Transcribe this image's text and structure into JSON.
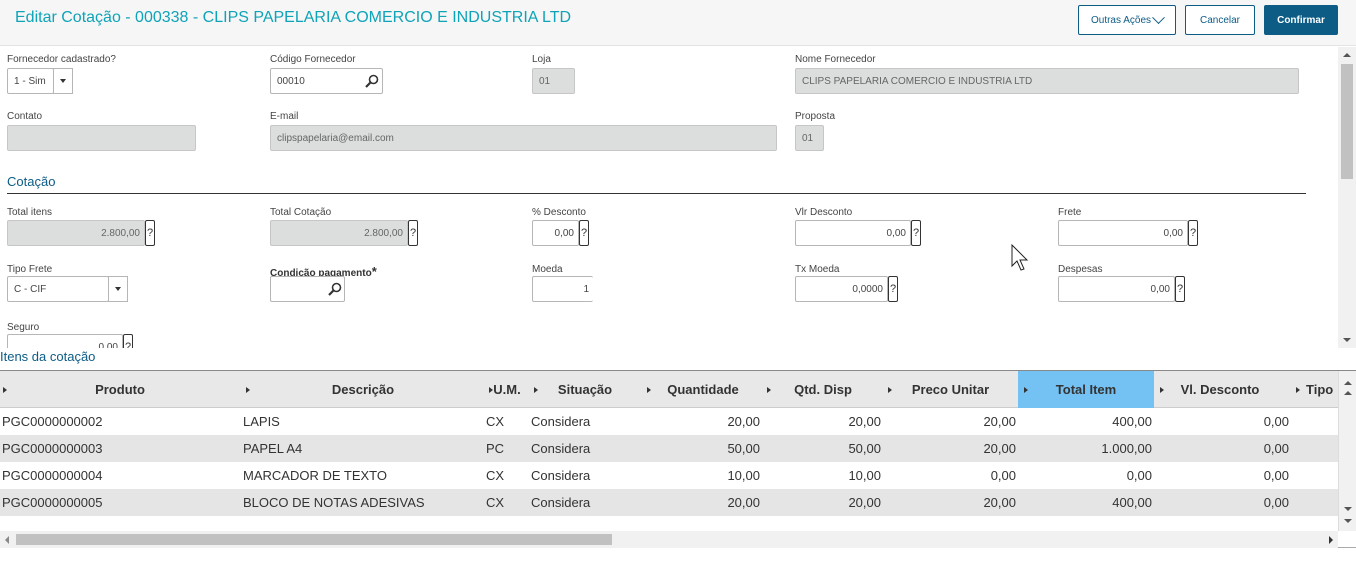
{
  "header": {
    "title": "Editar Cotação -  000338 - CLIPS PAPELARIA COMERCIO E INDUSTRIA LTD",
    "actions_label": "Outras Ações",
    "cancel_label": "Cancelar",
    "confirm_label": "Confirmar"
  },
  "form": {
    "fornecedor_cadastrado": {
      "label": "Fornecedor cadastrado?",
      "value": "1 - Sim"
    },
    "codigo_fornecedor": {
      "label": "Código Fornecedor",
      "value": "00010"
    },
    "loja": {
      "label": "Loja",
      "value": "01"
    },
    "nome_fornecedor": {
      "label": "Nome Fornecedor",
      "value": "CLIPS PAPELARIA COMERCIO E INDUSTRIA LTD"
    },
    "contato": {
      "label": "Contato",
      "value": ""
    },
    "email": {
      "label": "E-mail",
      "value": "clipspapelaria@email.com"
    },
    "proposta": {
      "label": "Proposta",
      "value": "01"
    }
  },
  "cotacao": {
    "section_title": "Cotação",
    "total_itens": {
      "label": "Total itens",
      "value": "2.800,00"
    },
    "total_cotacao": {
      "label": "Total Cotação",
      "value": "2.800,00"
    },
    "desconto_pct": {
      "label": "% Desconto",
      "value": "0,00"
    },
    "vlr_desconto": {
      "label": "Vlr Desconto",
      "value": "0,00"
    },
    "frete": {
      "label": "Frete",
      "value": "0,00"
    },
    "tipo_frete": {
      "label": "Tipo Frete",
      "value": "C - CIF"
    },
    "condicao_pagamento": {
      "label": "Condição pagamento",
      "required_mark": "*",
      "value": ""
    },
    "moeda": {
      "label": "Moeda",
      "value": "1"
    },
    "tx_moeda": {
      "label": "Tx Moeda",
      "value": "0,0000"
    },
    "despesas": {
      "label": "Despesas",
      "value": "0,00"
    },
    "seguro": {
      "label": "Seguro",
      "value": "0,00"
    },
    "help_glyph": "?"
  },
  "items": {
    "title": "Itens da cotação",
    "columns": [
      "Produto",
      "Descrição",
      "U.M.",
      "Situação",
      "Quantidade",
      "Qtd. Disp",
      "Preco Unitar",
      "Total Item",
      "Vl. Desconto",
      "Tipo"
    ],
    "rows": [
      [
        "PGC0000000002",
        "LAPIS",
        "CX",
        "Considera",
        "20,00",
        "20,00",
        "20,00",
        "400,00",
        "0,00"
      ],
      [
        "PGC0000000003",
        "PAPEL A4",
        "PC",
        "Considera",
        "50,00",
        "50,00",
        "20,00",
        "1.000,00",
        "0,00"
      ],
      [
        "PGC0000000004",
        "MARCADOR DE TEXTO",
        "CX",
        "Considera",
        "10,00",
        "10,00",
        "0,00",
        "0,00",
        "0,00"
      ],
      [
        "PGC0000000005",
        "BLOCO DE NOTAS ADESIVAS",
        "CX",
        "Considera",
        "20,00",
        "20,00",
        "20,00",
        "400,00",
        "0,00"
      ]
    ]
  },
  "icons": [
    "search-icon",
    "dropdown-arrow-icon",
    "chevron-down-icon",
    "mouse-cursor-icon"
  ],
  "colors": {
    "title": "#0fa3b8",
    "primary": "#0c5c86",
    "active_column": "#73c2f3",
    "readonly_bg": "#dcdddd"
  }
}
